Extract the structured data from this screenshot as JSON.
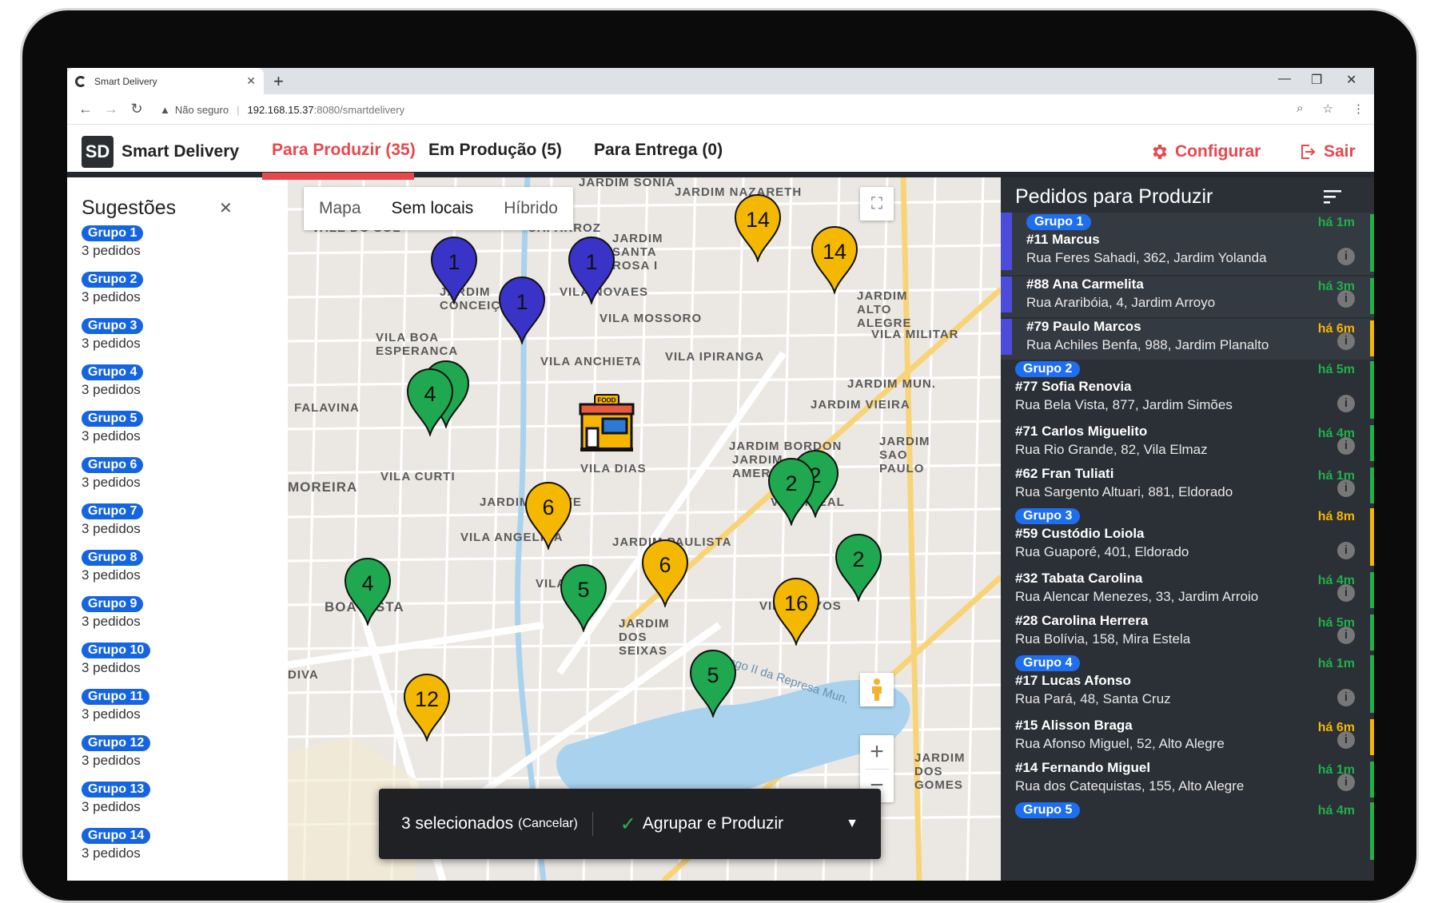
{
  "browser": {
    "tab_title": "Smart Delivery",
    "security_label": "Não seguro",
    "url_host": "192.168.15.37",
    "url_path": ":8080/smartdelivery"
  },
  "app": {
    "logo": "SD",
    "name": "Smart Delivery",
    "nav": [
      {
        "label": "Para Produzir (35)",
        "active": true
      },
      {
        "label": "Em Produção (5)",
        "active": false
      },
      {
        "label": "Para Entrega (0)",
        "active": false
      }
    ],
    "configure_label": "Configurar",
    "logout_label": "Sair",
    "accent_color": "#e8474c"
  },
  "suggestions": {
    "title": "Sugestões",
    "close_icon": "close-icon",
    "groups": [
      {
        "label": "Grupo 1",
        "count": "3 pedidos"
      },
      {
        "label": "Grupo 2",
        "count": "3 pedidos"
      },
      {
        "label": "Grupo 3",
        "count": "3 pedidos"
      },
      {
        "label": "Grupo 4",
        "count": "3 pedidos"
      },
      {
        "label": "Grupo 5",
        "count": "3 pedidos"
      },
      {
        "label": "Grupo 6",
        "count": "3 pedidos"
      },
      {
        "label": "Grupo 7",
        "count": "3 pedidos"
      },
      {
        "label": "Grupo 8",
        "count": "3 pedidos"
      },
      {
        "label": "Grupo 9",
        "count": "3 pedidos"
      },
      {
        "label": "Grupo 10",
        "count": "3 pedidos"
      },
      {
        "label": "Grupo 11",
        "count": "3 pedidos"
      },
      {
        "label": "Grupo 12",
        "count": "3 pedidos"
      },
      {
        "label": "Grupo 13",
        "count": "3 pedidos"
      },
      {
        "label": "Grupo 14",
        "count": "3 pedidos"
      }
    ]
  },
  "map": {
    "types": [
      "Mapa",
      "Sem locais",
      "Híbrido"
    ],
    "selected_type": "Sem locais",
    "store_label": "FOOD",
    "pin_colors": {
      "blue": "#3a33c8",
      "green": "#1fa84f",
      "yellow": "#f5b800"
    },
    "pins": [
      {
        "n": "1",
        "color": "blue"
      },
      {
        "n": "1",
        "color": "blue"
      },
      {
        "n": "1",
        "color": "blue"
      },
      {
        "n": "14",
        "color": "yellow"
      },
      {
        "n": "14",
        "color": "yellow"
      },
      {
        "n": "4",
        "color": "green"
      },
      {
        "n": "4",
        "color": "green"
      },
      {
        "n": "2",
        "color": "green"
      },
      {
        "n": "2",
        "color": "green"
      },
      {
        "n": "2",
        "color": "green"
      },
      {
        "n": "6",
        "color": "yellow"
      },
      {
        "n": "6",
        "color": "yellow"
      },
      {
        "n": "4",
        "color": "green"
      },
      {
        "n": "5",
        "color": "green"
      },
      {
        "n": "16",
        "color": "yellow"
      },
      {
        "n": "5",
        "color": "green"
      },
      {
        "n": "12",
        "color": "yellow"
      }
    ],
    "labels": [
      "JARDIM SONIA",
      "JARDIM NAZARETH",
      "VALE DO SOL",
      "CAPARROZ",
      "JARDIM SANTA ROSA I",
      "JARDIM CONCEIÇÃO",
      "VILA NOVAES",
      "VILA MOSSORO",
      "JARDIM ALTO ALEGRE",
      "VILA MILITAR",
      "VILA BOA ESPERANCA",
      "VILA ANCHIETA",
      "VILA IPIRANGA",
      "JARDIM MUN.",
      "JARDIM VIEIRA",
      "FALAVINA",
      "JARDIM BORDON",
      "JARDIM SAO PAULO",
      "JARDIM AMERICA",
      "VILA CURTI",
      "VILA DIAS",
      "MOREIRA",
      "JARDIM MONTE",
      "VILA IDEAL",
      "VILA ANGELICA",
      "JARDIM PAULISTA",
      "BOA VISTA",
      "VILA MA",
      "VILA GOYOS",
      "JARDIM DOS SEIXAS",
      "Lago II da Represa Mun.",
      "DIVA",
      "JARDIM DOS GOMES"
    ],
    "selection_count": "3 selecionados",
    "selection_cancel": "(Cancelar)",
    "action_label": "Agrupar e Produzir"
  },
  "orders": {
    "title": "Pedidos para Produzir",
    "colors": {
      "green": "#1fb14a",
      "yellow": "#f5b800"
    },
    "items": [
      {
        "group": "Grupo 1",
        "name": "#11 Marcus",
        "address": "Rua Feres Sahadi, 362, Jardim Yolanda",
        "time": "há 1m",
        "status": "green",
        "selected": true
      },
      {
        "group": "",
        "name": "#88 Ana Carmelita",
        "address": "Rua Araribóia, 4, Jardim Arroyo",
        "time": "há 3m",
        "status": "green",
        "selected": true
      },
      {
        "group": "",
        "name": "#79 Paulo Marcos",
        "address": "Rua Achiles Benfa, 988, Jardim Planalto",
        "time": "há 6m",
        "status": "yellow",
        "selected": true
      },
      {
        "group": "Grupo 2",
        "name": "#77 Sofia Renovia",
        "address": "Rua Bela Vista, 877, Jardim Simões",
        "time": "há 5m",
        "status": "green",
        "selected": false
      },
      {
        "group": "",
        "name": "#71 Carlos Miguelito",
        "address": "Rua Rio Grande, 82, Vila Elmaz",
        "time": "há 4m",
        "status": "green",
        "selected": false
      },
      {
        "group": "",
        "name": "#62 Fran Tuliati",
        "address": "Rua Sargento Altuari, 881, Eldorado",
        "time": "há 1m",
        "status": "green",
        "selected": false
      },
      {
        "group": "Grupo 3",
        "name": "#59 Custódio Loiola",
        "address": "Rua Guaporé, 401, Eldorado",
        "time": "há 8m",
        "status": "yellow",
        "selected": false
      },
      {
        "group": "",
        "name": "#32 Tabata Carolina",
        "address": "Rua Alencar Menezes, 33, Jardim Arroio",
        "time": "há 4m",
        "status": "green",
        "selected": false
      },
      {
        "group": "",
        "name": "#28 Carolina Herrera",
        "address": "Rua Bolívia, 158, Mira Estela",
        "time": "há 5m",
        "status": "green",
        "selected": false
      },
      {
        "group": "Grupo 4",
        "name": "#17 Lucas Afonso",
        "address": "Rua Pará, 48, Santa Cruz",
        "time": "há 1m",
        "status": "green",
        "selected": false
      },
      {
        "group": "",
        "name": "#15 Alisson Braga",
        "address": "Rua Afonso Miguel, 52, Alto Alegre",
        "time": "há 6m",
        "status": "yellow",
        "selected": false
      },
      {
        "group": "",
        "name": "#14 Fernando Miguel",
        "address": "Rua dos Catequistas, 155, Alto Alegre",
        "time": "há 1m",
        "status": "green",
        "selected": false
      },
      {
        "group": "Grupo 5",
        "name": "",
        "address": "",
        "time": "há 4m",
        "status": "green",
        "selected": false
      }
    ]
  }
}
